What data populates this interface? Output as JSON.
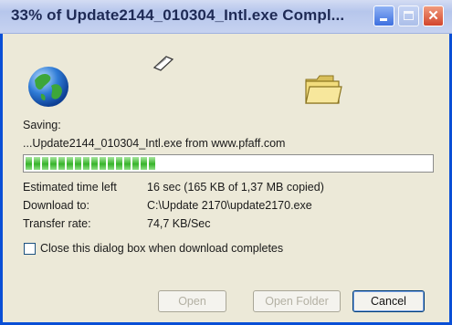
{
  "window": {
    "title": "33% of Update2144_010304_Intl.exe Compl..."
  },
  "icons": {
    "globe": "globe-icon",
    "document": "flying-document-icon",
    "folder": "folder-icon"
  },
  "status": {
    "saving_label": "Saving:",
    "source": "...Update2144_010304_Intl.exe from www.pfaff.com"
  },
  "progress": {
    "fraction": 0.33
  },
  "details": {
    "estimated_label": "Estimated time left",
    "estimated_value": "16 sec (165 KB of 1,37 MB copied)",
    "download_label": "Download to:",
    "download_value": "C:\\Update 2170\\update2170.exe",
    "rate_label": "Transfer rate:",
    "rate_value": "74,7 KB/Sec"
  },
  "options": {
    "close_when_done_label": "Close this dialog box when download completes",
    "close_when_done_checked": false
  },
  "buttons": {
    "open": "Open",
    "open_folder": "Open Folder",
    "cancel": "Cancel"
  },
  "colors": {
    "title_bar_border": "#0a4fd6",
    "progress": "#37b42a",
    "window_bg": "#ece9d8"
  }
}
